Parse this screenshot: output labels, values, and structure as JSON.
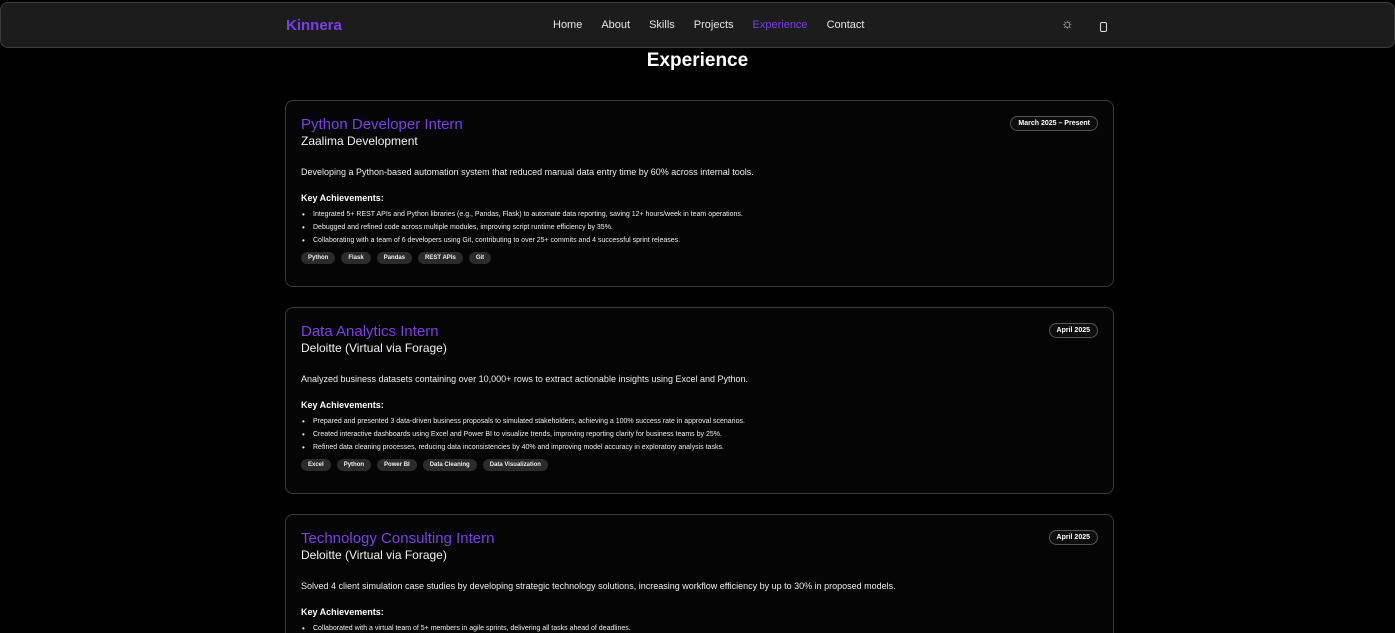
{
  "nav": {
    "brand": "Kinnera",
    "links": [
      "Home",
      "About",
      "Skills",
      "Projects",
      "Experience",
      "Contact"
    ],
    "active": "Experience",
    "theme_toggle_icon": "sun-icon",
    "mobile_icon": "device-icon",
    "theme_symbol": "☼"
  },
  "section": {
    "title": "Experience"
  },
  "experiences": [
    {
      "role": "Python Developer Intern",
      "company": "Zaalima Development",
      "date": "March 2025 – Present",
      "description": "Developing a Python-based automation system that reduced manual data entry time by 60% across internal tools.",
      "achievements_label": "Key Achievements:",
      "achievements": [
        "Integrated 5+ REST APIs and Python libraries (e.g., Pandas, Flask) to automate data reporting, saving 12+ hours/week in team operations.",
        "Debugged and refined code across multiple modules, improving script runtime efficiency by 35%.",
        "Collaborating with a team of 6 developers using Git, contributing to over 25+ commits and 4 successful sprint releases."
      ],
      "tags": [
        "Python",
        "Flask",
        "Pandas",
        "REST APIs",
        "Git"
      ]
    },
    {
      "role": "Data Analytics Intern",
      "company": "Deloitte (Virtual via Forage)",
      "date": "April 2025",
      "description": "Analyzed business datasets containing over 10,000+ rows to extract actionable insights using Excel and Python.",
      "achievements_label": "Key Achievements:",
      "achievements": [
        "Prepared and presented 3 data-driven business proposals to simulated stakeholders, achieving a 100% success rate in approval scenarios.",
        "Created interactive dashboards using Excel and Power BI to visualize trends, improving reporting clarity for business teams by 25%.",
        "Refined data cleaning processes, reducing data inconsistencies by 40% and improving model accuracy in exploratory analysis tasks."
      ],
      "tags": [
        "Excel",
        "Python",
        "Power BI",
        "Data Cleaning",
        "Data Visualization"
      ]
    },
    {
      "role": "Technology Consulting Intern",
      "company": "Deloitte (Virtual via Forage)",
      "date": "April 2025",
      "description": "Solved 4 client simulation case studies by developing strategic technology solutions, increasing workflow efficiency by up to 30% in proposed models.",
      "achievements_label": "Key Achievements:",
      "achievements": [
        "Collaborated with a virtual team of 5+ members in agile sprints, delivering all tasks ahead of deadlines."
      ],
      "tags": []
    }
  ],
  "colors": {
    "accent": "#7b3fe4",
    "background": "#000000",
    "card_border": "#3a3a3a"
  }
}
